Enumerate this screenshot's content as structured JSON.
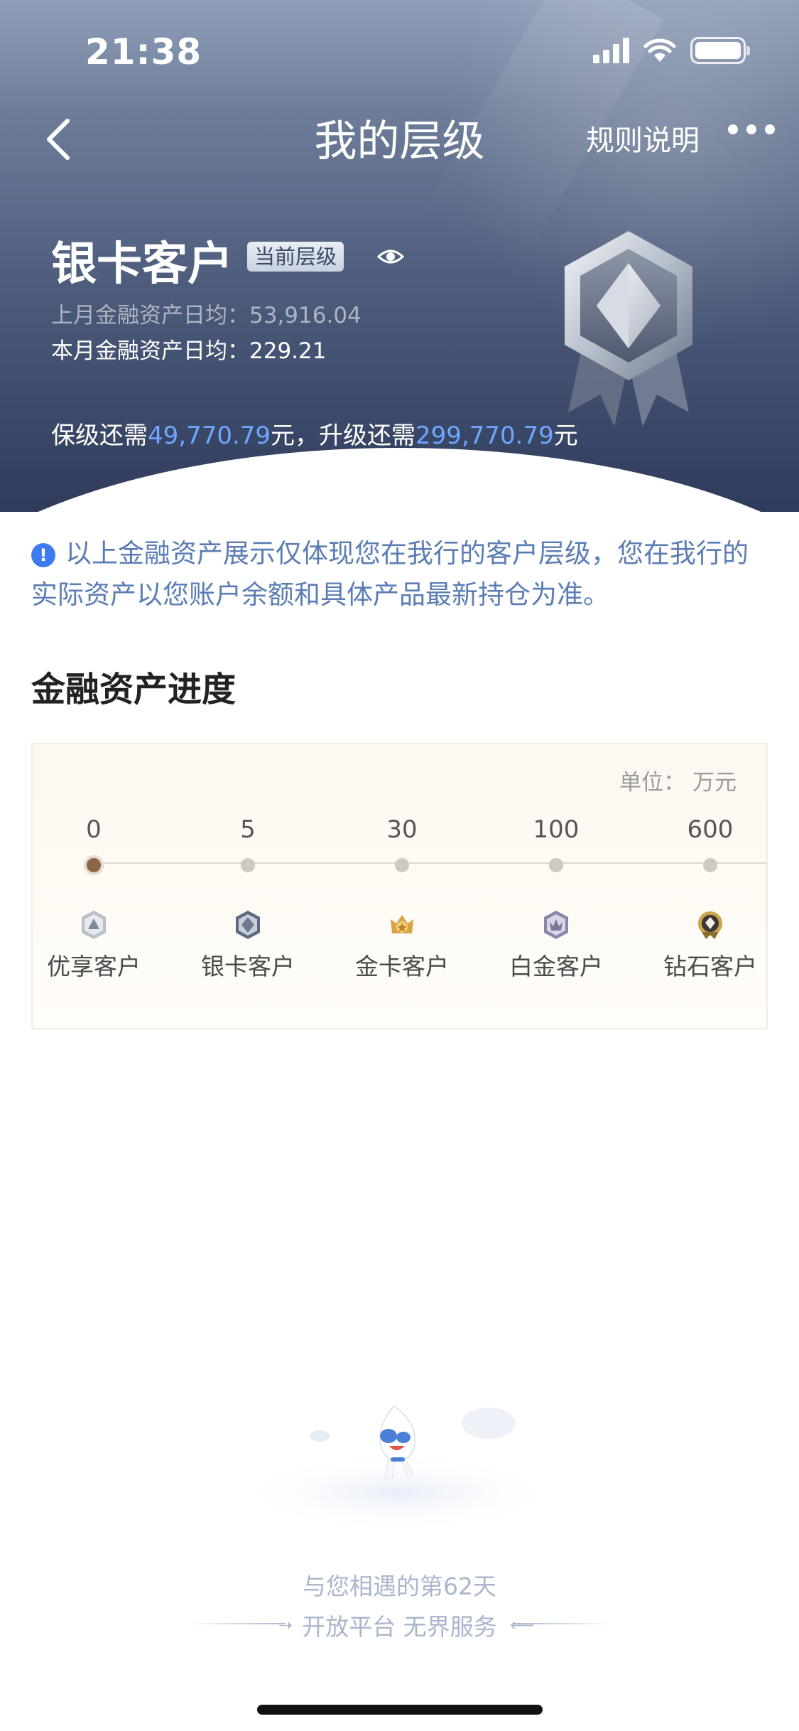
{
  "status_bar": {
    "time": "21:38"
  },
  "nav": {
    "title": "我的层级",
    "rules_label": "规则说明"
  },
  "tier": {
    "name": "银卡客户",
    "current_badge": "当前层级",
    "last_month_avg": "上月金融资产日均：53,916.04",
    "this_month_avg": "本月金融资产日均：229.21",
    "keep_prefix": "保级还需",
    "keep_amount": "49,770.79",
    "keep_suffix": "元，升级还需",
    "upgrade_amount": "299,770.79",
    "upgrade_suffix": "元"
  },
  "notice": {
    "text": "以上金融资产展示仅体现您在我行的客户层级，您在我行的实际资产以您账户余额和具体产品最新持仓为准。"
  },
  "progress": {
    "title": "金融资产进度",
    "unit": "单位：  万元",
    "stops": [
      {
        "value": "0",
        "label": "优享客户",
        "icon": "youxiang-badge-icon"
      },
      {
        "value": "5",
        "label": "银卡客户",
        "icon": "silver-badge-icon"
      },
      {
        "value": "30",
        "label": "金卡客户",
        "icon": "gold-badge-icon"
      },
      {
        "value": "100",
        "label": "白金客户",
        "icon": "platinum-badge-icon"
      },
      {
        "value": "600",
        "label": "钻石客户",
        "icon": "diamond-badge-icon"
      }
    ],
    "current_index": 0
  },
  "footer": {
    "days_text": "与您相遇的第62天",
    "slogan": "开放平台 无界服务"
  },
  "colors": {
    "accent_blue": "#6fa6ff",
    "notice_blue": "#5b7db4",
    "hero_dark": "#2f3b5b"
  }
}
